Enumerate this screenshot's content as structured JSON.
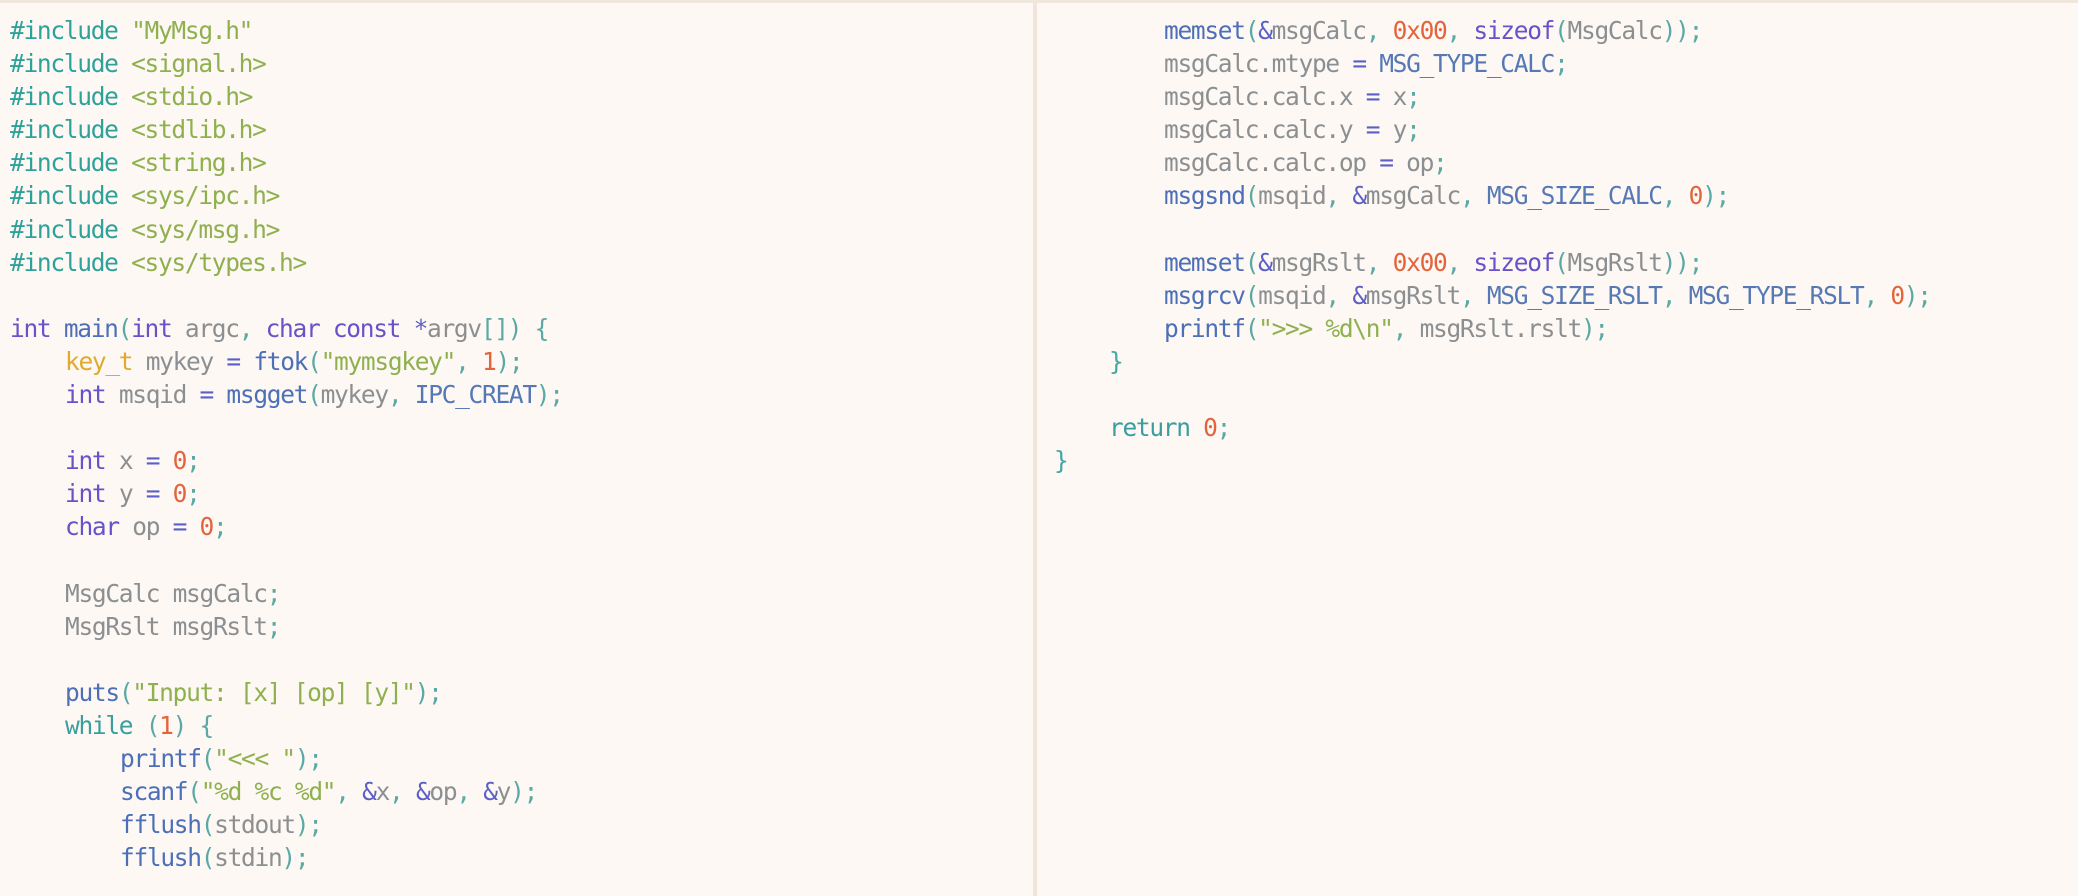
{
  "editor": {
    "left_lines": [
      [
        {
          "t": "#include ",
          "c": "pp"
        },
        {
          "t": "\"MyMsg.h\"",
          "c": "str"
        }
      ],
      [
        {
          "t": "#include ",
          "c": "pp"
        },
        {
          "t": "<signal.h>",
          "c": "str"
        }
      ],
      [
        {
          "t": "#include ",
          "c": "pp"
        },
        {
          "t": "<stdio.h>",
          "c": "str"
        }
      ],
      [
        {
          "t": "#include ",
          "c": "pp"
        },
        {
          "t": "<stdlib.h>",
          "c": "str"
        }
      ],
      [
        {
          "t": "#include ",
          "c": "pp"
        },
        {
          "t": "<string.h>",
          "c": "str"
        }
      ],
      [
        {
          "t": "#include ",
          "c": "pp"
        },
        {
          "t": "<sys/ipc.h>",
          "c": "str"
        }
      ],
      [
        {
          "t": "#include ",
          "c": "pp"
        },
        {
          "t": "<sys/msg.h>",
          "c": "str"
        }
      ],
      [
        {
          "t": "#include ",
          "c": "pp"
        },
        {
          "t": "<sys/types.h>",
          "c": "str"
        }
      ],
      [],
      [
        {
          "t": "int ",
          "c": "kw"
        },
        {
          "t": "main",
          "c": "fn"
        },
        {
          "t": "(",
          "c": "pn"
        },
        {
          "t": "int ",
          "c": "kw"
        },
        {
          "t": "argc",
          "c": "var"
        },
        {
          "t": ", ",
          "c": "pn"
        },
        {
          "t": "char const ",
          "c": "kw"
        },
        {
          "t": "*",
          "c": "op"
        },
        {
          "t": "argv",
          "c": "var"
        },
        {
          "t": "[]) {",
          "c": "pn"
        }
      ],
      [
        {
          "t": "key_t ",
          "c": "ty"
        },
        {
          "t": "mykey ",
          "c": "var"
        },
        {
          "t": "= ",
          "c": "op"
        },
        {
          "t": "ftok",
          "c": "fn"
        },
        {
          "t": "(",
          "c": "pn"
        },
        {
          "t": "\"mymsgkey\"",
          "c": "str"
        },
        {
          "t": ", ",
          "c": "pn"
        },
        {
          "t": "1",
          "c": "num"
        },
        {
          "t": ");",
          "c": "pn"
        }
      ],
      [
        {
          "t": "int ",
          "c": "kw"
        },
        {
          "t": "msqid ",
          "c": "var"
        },
        {
          "t": "= ",
          "c": "op"
        },
        {
          "t": "msgget",
          "c": "fn"
        },
        {
          "t": "(",
          "c": "pn"
        },
        {
          "t": "mykey",
          "c": "var"
        },
        {
          "t": ", ",
          "c": "pn"
        },
        {
          "t": "IPC_CREAT",
          "c": "cst"
        },
        {
          "t": ");",
          "c": "pn"
        }
      ],
      [],
      [
        {
          "t": "int ",
          "c": "kw"
        },
        {
          "t": "x ",
          "c": "var"
        },
        {
          "t": "= ",
          "c": "op"
        },
        {
          "t": "0",
          "c": "num"
        },
        {
          "t": ";",
          "c": "pn"
        }
      ],
      [
        {
          "t": "int ",
          "c": "kw"
        },
        {
          "t": "y ",
          "c": "var"
        },
        {
          "t": "= ",
          "c": "op"
        },
        {
          "t": "0",
          "c": "num"
        },
        {
          "t": ";",
          "c": "pn"
        }
      ],
      [
        {
          "t": "char ",
          "c": "kw"
        },
        {
          "t": "op ",
          "c": "var"
        },
        {
          "t": "= ",
          "c": "op"
        },
        {
          "t": "0",
          "c": "num"
        },
        {
          "t": ";",
          "c": "pn"
        }
      ],
      [],
      [
        {
          "t": "MsgCalc msgCalc",
          "c": "var"
        },
        {
          "t": ";",
          "c": "pn"
        }
      ],
      [
        {
          "t": "MsgRslt msgRslt",
          "c": "var"
        },
        {
          "t": ";",
          "c": "pn"
        }
      ],
      [],
      [
        {
          "t": "puts",
          "c": "fn"
        },
        {
          "t": "(",
          "c": "pn"
        },
        {
          "t": "\"Input: [x] [op] [y]\"",
          "c": "str"
        },
        {
          "t": ");",
          "c": "pn"
        }
      ],
      [
        {
          "t": "while ",
          "c": "ctl"
        },
        {
          "t": "(",
          "c": "pn"
        },
        {
          "t": "1",
          "c": "num"
        },
        {
          "t": ") {",
          "c": "pn"
        }
      ],
      [
        {
          "t": "printf",
          "c": "fn"
        },
        {
          "t": "(",
          "c": "pn"
        },
        {
          "t": "\"<<< \"",
          "c": "str"
        },
        {
          "t": ");",
          "c": "pn"
        }
      ],
      [
        {
          "t": "scanf",
          "c": "fn"
        },
        {
          "t": "(",
          "c": "pn"
        },
        {
          "t": "\"%d %c %d\"",
          "c": "str"
        },
        {
          "t": ", ",
          "c": "pn"
        },
        {
          "t": "&",
          "c": "op"
        },
        {
          "t": "x",
          "c": "var"
        },
        {
          "t": ", ",
          "c": "pn"
        },
        {
          "t": "&",
          "c": "op"
        },
        {
          "t": "op",
          "c": "var"
        },
        {
          "t": ", ",
          "c": "pn"
        },
        {
          "t": "&",
          "c": "op"
        },
        {
          "t": "y",
          "c": "var"
        },
        {
          "t": ");",
          "c": "pn"
        }
      ],
      [
        {
          "t": "fflush",
          "c": "fn"
        },
        {
          "t": "(",
          "c": "pn"
        },
        {
          "t": "stdout",
          "c": "var"
        },
        {
          "t": ");",
          "c": "pn"
        }
      ],
      [
        {
          "t": "fflush",
          "c": "fn"
        },
        {
          "t": "(",
          "c": "pn"
        },
        {
          "t": "stdin",
          "c": "var"
        },
        {
          "t": ");",
          "c": "pn"
        }
      ]
    ],
    "left_indent": [
      0,
      0,
      0,
      0,
      0,
      0,
      0,
      0,
      0,
      0,
      4,
      4,
      0,
      4,
      4,
      4,
      0,
      4,
      4,
      0,
      4,
      4,
      8,
      8,
      8,
      8
    ],
    "right_lines": [
      [
        {
          "t": "memset",
          "c": "fn"
        },
        {
          "t": "(",
          "c": "pn"
        },
        {
          "t": "&",
          "c": "op"
        },
        {
          "t": "msgCalc",
          "c": "var"
        },
        {
          "t": ", ",
          "c": "pn"
        },
        {
          "t": "0x00",
          "c": "num"
        },
        {
          "t": ", ",
          "c": "pn"
        },
        {
          "t": "sizeof",
          "c": "kw"
        },
        {
          "t": "(",
          "c": "pn"
        },
        {
          "t": "MsgCalc",
          "c": "var"
        },
        {
          "t": "));",
          "c": "pn"
        }
      ],
      [
        {
          "t": "msgCalc.mtype ",
          "c": "var"
        },
        {
          "t": "= ",
          "c": "op"
        },
        {
          "t": "MSG_TYPE_CALC",
          "c": "cst"
        },
        {
          "t": ";",
          "c": "pn"
        }
      ],
      [
        {
          "t": "msgCalc.calc.x ",
          "c": "var"
        },
        {
          "t": "= ",
          "c": "op"
        },
        {
          "t": "x",
          "c": "var"
        },
        {
          "t": ";",
          "c": "pn"
        }
      ],
      [
        {
          "t": "msgCalc.calc.y ",
          "c": "var"
        },
        {
          "t": "= ",
          "c": "op"
        },
        {
          "t": "y",
          "c": "var"
        },
        {
          "t": ";",
          "c": "pn"
        }
      ],
      [
        {
          "t": "msgCalc.calc.op ",
          "c": "var"
        },
        {
          "t": "= ",
          "c": "op"
        },
        {
          "t": "op",
          "c": "var"
        },
        {
          "t": ";",
          "c": "pn"
        }
      ],
      [
        {
          "t": "msgsnd",
          "c": "fn"
        },
        {
          "t": "(",
          "c": "pn"
        },
        {
          "t": "msqid",
          "c": "var"
        },
        {
          "t": ", ",
          "c": "pn"
        },
        {
          "t": "&",
          "c": "op"
        },
        {
          "t": "msgCalc",
          "c": "var"
        },
        {
          "t": ", ",
          "c": "pn"
        },
        {
          "t": "MSG_SIZE_CALC",
          "c": "cst"
        },
        {
          "t": ", ",
          "c": "pn"
        },
        {
          "t": "0",
          "c": "num"
        },
        {
          "t": ");",
          "c": "pn"
        }
      ],
      [],
      [
        {
          "t": "memset",
          "c": "fn"
        },
        {
          "t": "(",
          "c": "pn"
        },
        {
          "t": "&",
          "c": "op"
        },
        {
          "t": "msgRslt",
          "c": "var"
        },
        {
          "t": ", ",
          "c": "pn"
        },
        {
          "t": "0x00",
          "c": "num"
        },
        {
          "t": ", ",
          "c": "pn"
        },
        {
          "t": "sizeof",
          "c": "kw"
        },
        {
          "t": "(",
          "c": "pn"
        },
        {
          "t": "MsgRslt",
          "c": "var"
        },
        {
          "t": "));",
          "c": "pn"
        }
      ],
      [
        {
          "t": "msgrcv",
          "c": "fn"
        },
        {
          "t": "(",
          "c": "pn"
        },
        {
          "t": "msqid",
          "c": "var"
        },
        {
          "t": ", ",
          "c": "pn"
        },
        {
          "t": "&",
          "c": "op"
        },
        {
          "t": "msgRslt",
          "c": "var"
        },
        {
          "t": ", ",
          "c": "pn"
        },
        {
          "t": "MSG_SIZE_RSLT",
          "c": "cst"
        },
        {
          "t": ", ",
          "c": "pn"
        },
        {
          "t": "MSG_TYPE_RSLT",
          "c": "cst"
        },
        {
          "t": ", ",
          "c": "pn"
        },
        {
          "t": "0",
          "c": "num"
        },
        {
          "t": ");",
          "c": "pn"
        }
      ],
      [
        {
          "t": "printf",
          "c": "fn"
        },
        {
          "t": "(",
          "c": "pn"
        },
        {
          "t": "\">>> %d\\n\"",
          "c": "str"
        },
        {
          "t": ", ",
          "c": "pn"
        },
        {
          "t": "msgRslt.rslt",
          "c": "var"
        },
        {
          "t": ");",
          "c": "pn"
        }
      ],
      [
        {
          "t": "}",
          "c": "br"
        }
      ],
      [],
      [
        {
          "t": "return ",
          "c": "ctl"
        },
        {
          "t": "0",
          "c": "num"
        },
        {
          "t": ";",
          "c": "pn"
        }
      ],
      [
        {
          "t": "}",
          "c": "br"
        }
      ]
    ],
    "right_indent": [
      8,
      8,
      8,
      8,
      8,
      8,
      0,
      8,
      8,
      8,
      4,
      0,
      4,
      0
    ],
    "colors": {
      "background": "#fdf8f3",
      "preprocessor": "#2ea29a",
      "string": "#8fb04f",
      "keyword": "#6753c8",
      "function": "#4c6fb8",
      "number": "#e3643c",
      "type": "#e0a92f",
      "identifier": "#8c8f92"
    }
  }
}
